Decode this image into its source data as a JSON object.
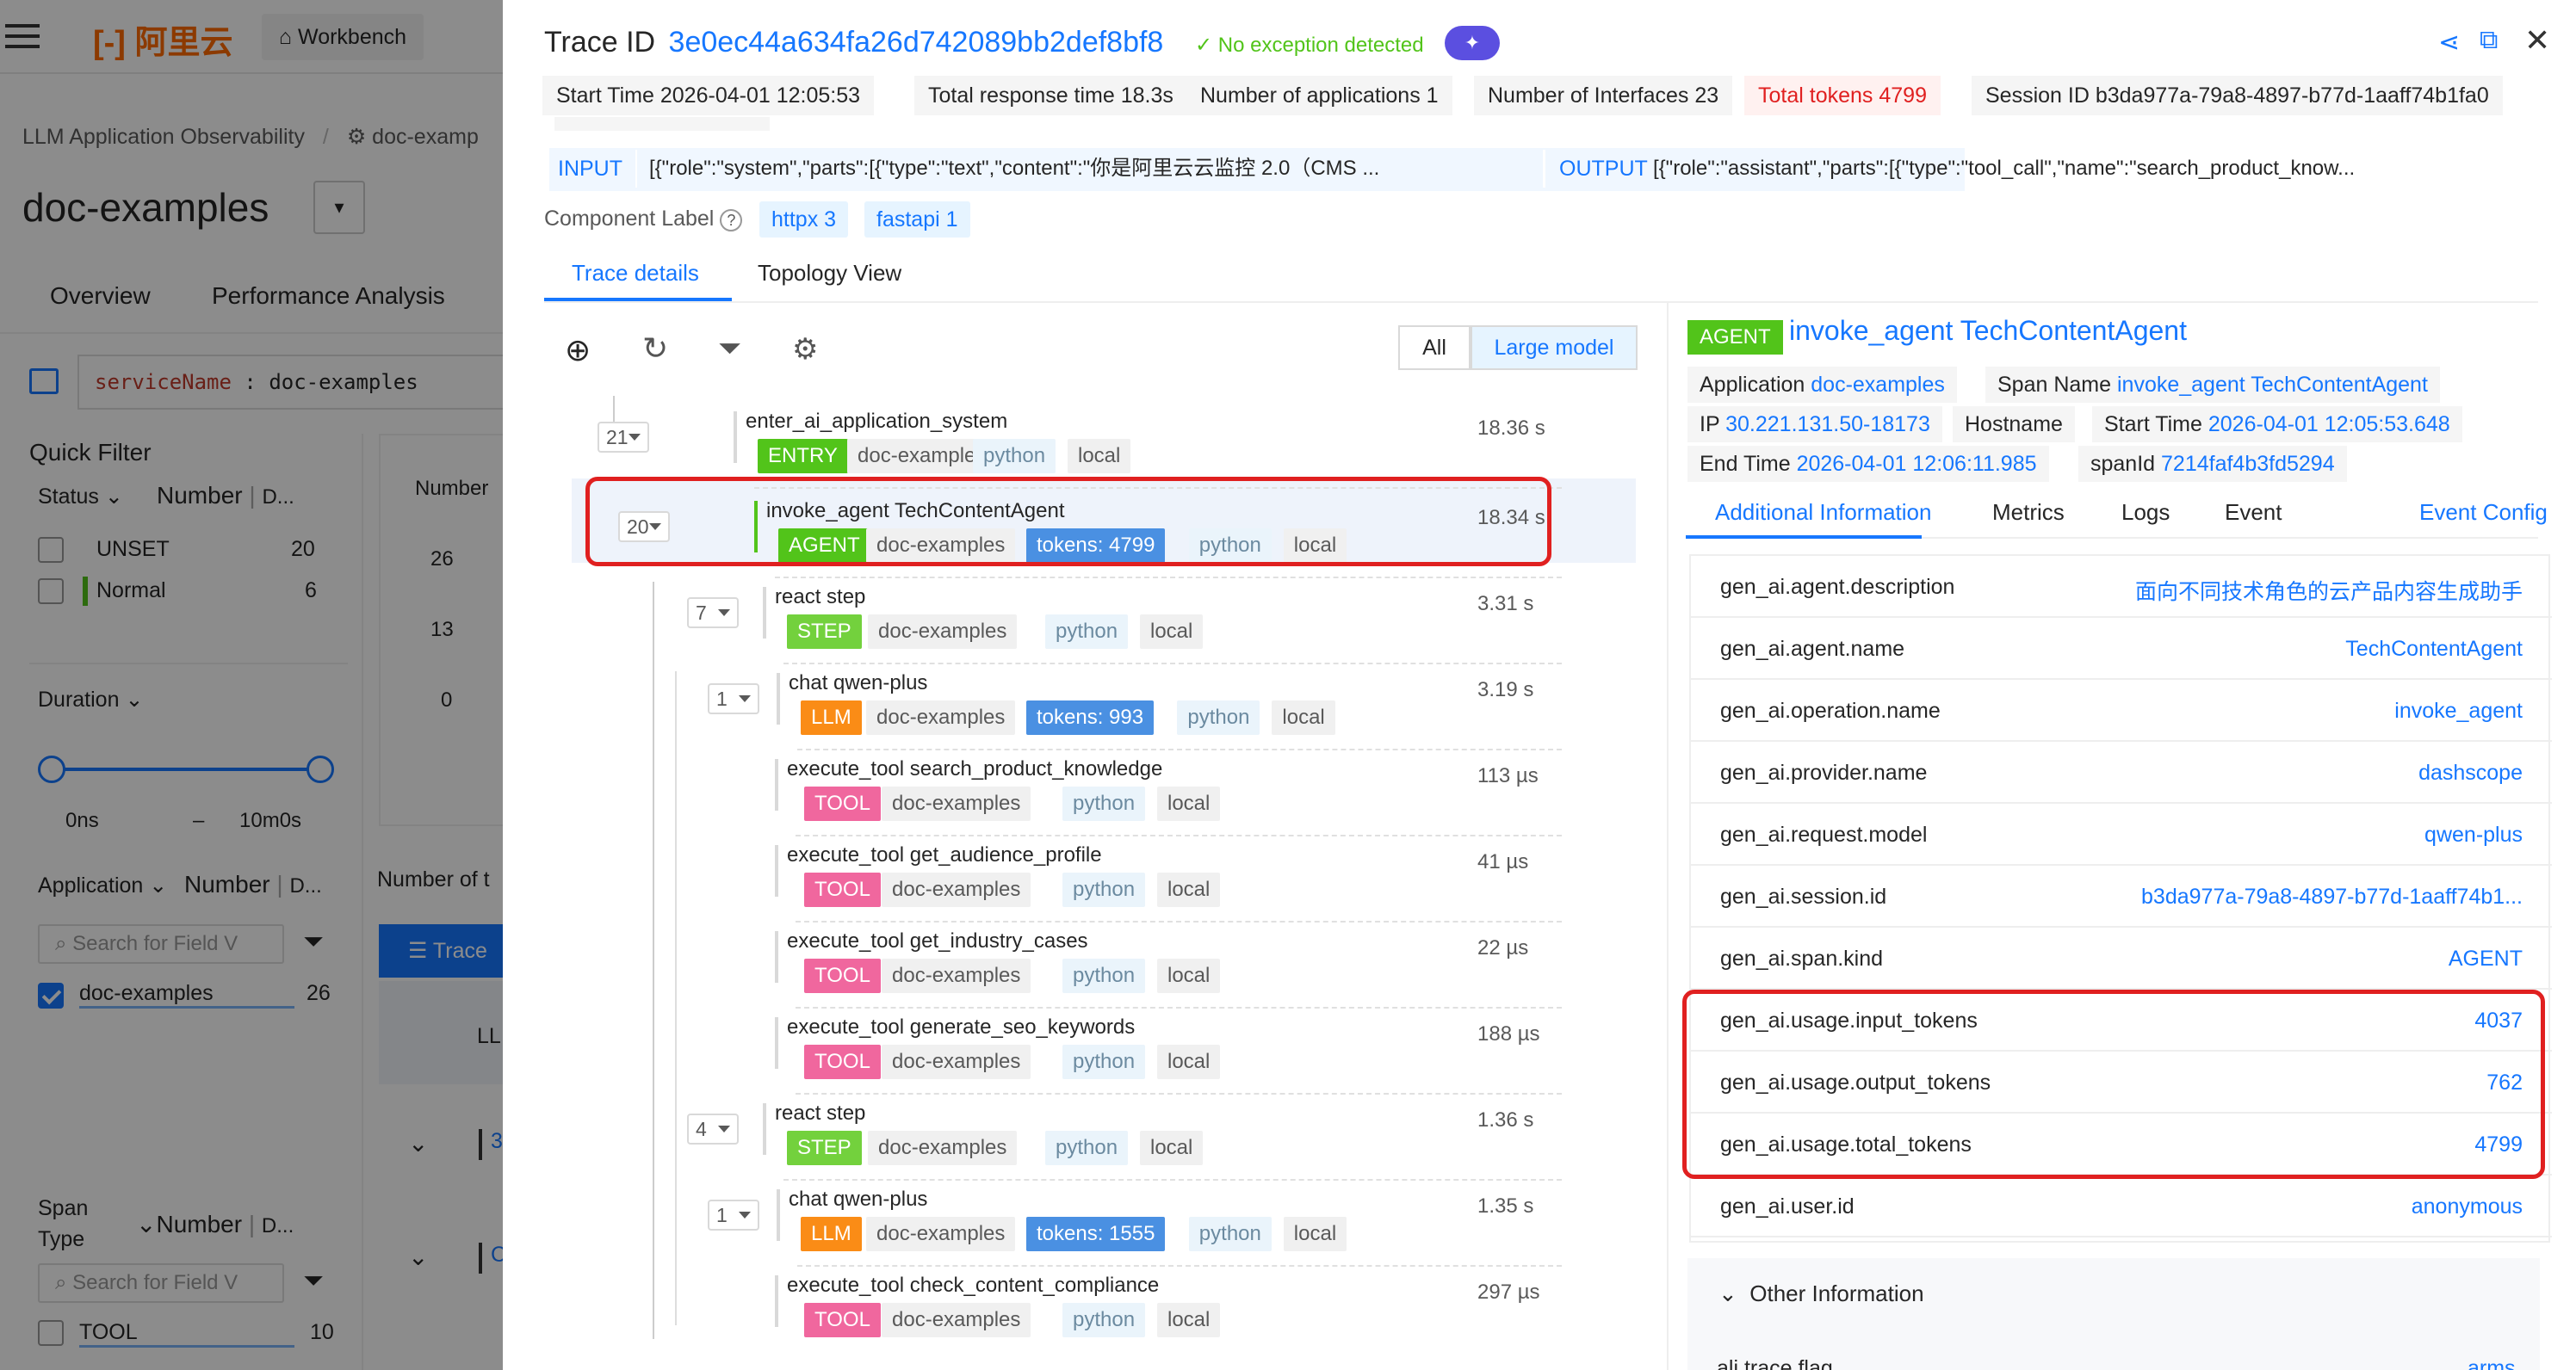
{
  "bg": {
    "brand": "阿里云",
    "workbench": "Workbench",
    "breadcrumb_1": "LLM Application Observability",
    "breadcrumb_sep": "/",
    "breadcrumb_2": "doc-examp",
    "app_title": "doc-examples",
    "nav": [
      "Overview",
      "Performance Analysis"
    ],
    "query_key": "serviceName",
    "query_op": ":",
    "query_val": "doc-examples",
    "quick_filter": "Quick Filter",
    "status_label": "Status",
    "number_label": "Number",
    "d_label": "D...",
    "status_items": [
      {
        "label": "UNSET",
        "count": "20"
      },
      {
        "label": "Normal",
        "count": "6"
      }
    ],
    "duration_label": "Duration",
    "dur_min": "0ns",
    "dur_sep": "–",
    "dur_max": "10m0s",
    "application_label": "Application",
    "search_placeholder": "Search for Field V",
    "app_items": [
      {
        "label": "doc-examples",
        "count": "26"
      }
    ],
    "span_type_label_1": "Span",
    "span_type_label_2": "Type",
    "span_items": [
      {
        "label": "TOOL",
        "count": "10"
      }
    ],
    "chart_number": "Number",
    "chart_ticks": [
      "26",
      "13",
      "0"
    ],
    "number_of": "Number of t",
    "trace_btn": "Trace",
    "ll": "LL",
    "row_a": "3",
    "row_b": "C"
  },
  "header": {
    "trace_id_label": "Trace ID",
    "trace_id": "3e0ec44a634fa26d742089bb2def8bf8",
    "no_exception": "No exception detected"
  },
  "meta": {
    "start_label": "Start Time",
    "start": "2026-04-01 12:05:53",
    "resp_label": "Total response time",
    "resp": "18.3s",
    "apps_label": "Number of applications",
    "apps": "1",
    "ifaces_label": "Number of Interfaces",
    "ifaces": "23",
    "tokens_label": "Total tokens",
    "tokens": "4799",
    "session_label": "Session ID",
    "session": "b3da977a-79a8-4897-b77d-1aaff74b1fa0"
  },
  "io": {
    "input_label": "INPUT",
    "input": "[{\"role\":\"system\",\"parts\":[{\"type\":\"text\",\"content\":\"你是阿里云云监控 2.0（CMS ...",
    "output_label": "OUTPUT",
    "output": "[{\"role\":\"assistant\",\"parts\":[{\"type\":\"tool_call\",\"name\":\"search_product_know..."
  },
  "component": {
    "label": "Component Label",
    "chips": [
      "httpx 3",
      "fastapi 1"
    ]
  },
  "tabs": [
    "Trace details",
    "Topology View"
  ],
  "filter": {
    "all": "All",
    "large": "Large model"
  },
  "spans": [
    {
      "count": "21",
      "name": "enter_ai_application_system",
      "type": "ENTRY",
      "app": "doc-examples",
      "tokens": "",
      "lang": "python",
      "loc": "local",
      "dur": "18.36 s"
    },
    {
      "count": "20",
      "name": "invoke_agent TechContentAgent",
      "type": "AGENT",
      "app": "doc-examples",
      "tokens": "tokens: 4799",
      "lang": "python",
      "loc": "local",
      "dur": "18.34 s"
    },
    {
      "count": "7",
      "name": "react step",
      "type": "STEP",
      "app": "doc-examples",
      "tokens": "",
      "lang": "python",
      "loc": "local",
      "dur": "3.31 s"
    },
    {
      "count": "1",
      "name": "chat qwen-plus",
      "type": "LLM",
      "app": "doc-examples",
      "tokens": "tokens: 993",
      "lang": "python",
      "loc": "local",
      "dur": "3.19 s"
    },
    {
      "count": "",
      "name": "execute_tool search_product_knowledge",
      "type": "TOOL",
      "app": "doc-examples",
      "tokens": "",
      "lang": "python",
      "loc": "local",
      "dur": "113 µs"
    },
    {
      "count": "",
      "name": "execute_tool get_audience_profile",
      "type": "TOOL",
      "app": "doc-examples",
      "tokens": "",
      "lang": "python",
      "loc": "local",
      "dur": "41 µs"
    },
    {
      "count": "",
      "name": "execute_tool get_industry_cases",
      "type": "TOOL",
      "app": "doc-examples",
      "tokens": "",
      "lang": "python",
      "loc": "local",
      "dur": "22 µs"
    },
    {
      "count": "",
      "name": "execute_tool generate_seo_keywords",
      "type": "TOOL",
      "app": "doc-examples",
      "tokens": "",
      "lang": "python",
      "loc": "local",
      "dur": "188 µs"
    },
    {
      "count": "4",
      "name": "react step",
      "type": "STEP",
      "app": "doc-examples",
      "tokens": "",
      "lang": "python",
      "loc": "local",
      "dur": "1.36 s"
    },
    {
      "count": "1",
      "name": "chat qwen-plus",
      "type": "LLM",
      "app": "doc-examples",
      "tokens": "tokens: 1555",
      "lang": "python",
      "loc": "local",
      "dur": "1.35 s"
    },
    {
      "count": "",
      "name": "execute_tool check_content_compliance",
      "type": "TOOL",
      "app": "doc-examples",
      "tokens": "",
      "lang": "python",
      "loc": "local",
      "dur": "297 µs"
    }
  ],
  "detail": {
    "badge": "AGENT",
    "title": "invoke_agent TechContentAgent",
    "app_label": "Application",
    "app": "doc-examples",
    "span_label": "Span Name",
    "span": "invoke_agent TechContentAgent",
    "ip_label": "IP",
    "ip": "30.221.131.50-18173",
    "host_label": "Hostname",
    "start_label": "Start Time",
    "start": "2026-04-01 12:05:53.648",
    "end_label": "End Time",
    "end": "2026-04-01 12:06:11.985",
    "spanid_label": "spanId",
    "spanid": "7214faf4b3fd5294",
    "tabs": [
      "Additional Information",
      "Metrics",
      "Logs",
      "Event"
    ],
    "event_config": "Event Config",
    "attrs": [
      {
        "k": "gen_ai.agent.description",
        "v": "面向不同技术角色的云产品内容生成助手"
      },
      {
        "k": "gen_ai.agent.name",
        "v": "TechContentAgent"
      },
      {
        "k": "gen_ai.operation.name",
        "v": "invoke_agent"
      },
      {
        "k": "gen_ai.provider.name",
        "v": "dashscope"
      },
      {
        "k": "gen_ai.request.model",
        "v": "qwen-plus"
      },
      {
        "k": "gen_ai.session.id",
        "v": "b3da977a-79a8-4897-b77d-1aaff74b1..."
      },
      {
        "k": "gen_ai.span.kind",
        "v": "AGENT"
      },
      {
        "k": "gen_ai.usage.input_tokens",
        "v": "4037"
      },
      {
        "k": "gen_ai.usage.output_tokens",
        "v": "762"
      },
      {
        "k": "gen_ai.usage.total_tokens",
        "v": "4799"
      },
      {
        "k": "gen_ai.user.id",
        "v": "anonymous"
      }
    ],
    "other_info": "Other Information",
    "partial_key": "ali.trace.flag",
    "partial_val": "arms"
  },
  "colors": {
    "accent": "#1677ff",
    "highlight": "#e02020",
    "danger_text": "#e02020"
  }
}
